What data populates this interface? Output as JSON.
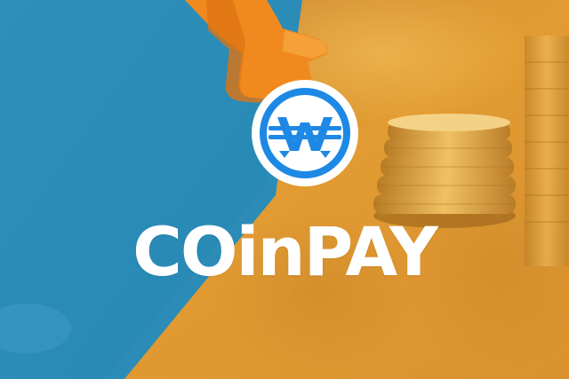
{
  "brand": {
    "name": "COinPAY",
    "logo_icon": "wcoin-logo-icon"
  },
  "colors": {
    "blue_panel": "#2b8cb8",
    "gold_background": "#d99531",
    "hand": "#f08a1e",
    "logo_ring": "#1e88e5",
    "logo_face": "#ffffff",
    "wordmark": "#ffffff"
  },
  "icons": {
    "hand": "pointing-hand-icon",
    "coins": "coin-stack-icon"
  }
}
